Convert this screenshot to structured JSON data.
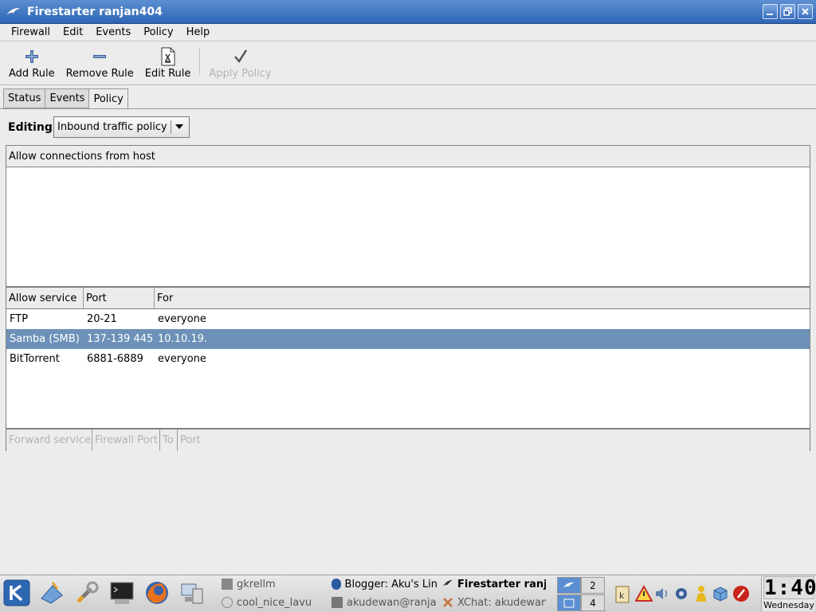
{
  "window": {
    "title": "Firestarter ranjan404",
    "icon": "firestarter-icon"
  },
  "menubar": {
    "items": [
      {
        "label": "Firewall"
      },
      {
        "label": "Edit"
      },
      {
        "label": "Events"
      },
      {
        "label": "Policy"
      },
      {
        "label": "Help"
      }
    ]
  },
  "toolbar": {
    "add_rule": "Add Rule",
    "remove_rule": "Remove Rule",
    "edit_rule": "Edit Rule",
    "apply_policy": "Apply Policy"
  },
  "tabs": [
    {
      "label": "Status"
    },
    {
      "label": "Events"
    },
    {
      "label": "Policy",
      "active": true
    }
  ],
  "editing": {
    "label": "Editing",
    "selected_policy": "Inbound traffic policy"
  },
  "hosts_list": {
    "header": "Allow connections from host",
    "rows": []
  },
  "services_list": {
    "headers": [
      "Allow service",
      "Port",
      "For"
    ],
    "rows": [
      {
        "service": "FTP",
        "port": "20-21",
        "for": "everyone",
        "selected": false
      },
      {
        "service": "Samba (SMB)",
        "port": "137-139 445",
        "for": "10.10.19.",
        "selected": true
      },
      {
        "service": "BitTorrent",
        "port": "6881-6889",
        "for": "everyone",
        "selected": false
      }
    ]
  },
  "forward_list": {
    "headers": [
      "Forward service",
      "Firewall Port",
      "To",
      "Port"
    ]
  },
  "taskbar": {
    "tasks": [
      {
        "label": "gkrellm"
      },
      {
        "label": "cool_nice_lavu"
      },
      {
        "label": "Blogger: Aku's Lin"
      },
      {
        "label": "Firestarter ranj"
      },
      {
        "label": "akudewan@ranja"
      },
      {
        "label": "XChat: akudewan"
      }
    ],
    "pager": [
      "2",
      "4"
    ],
    "clock": {
      "time": "1:40",
      "day": "Wednesday"
    }
  },
  "colors": {
    "titlebar": "#2f66b5",
    "selection": "#6d91b8"
  }
}
